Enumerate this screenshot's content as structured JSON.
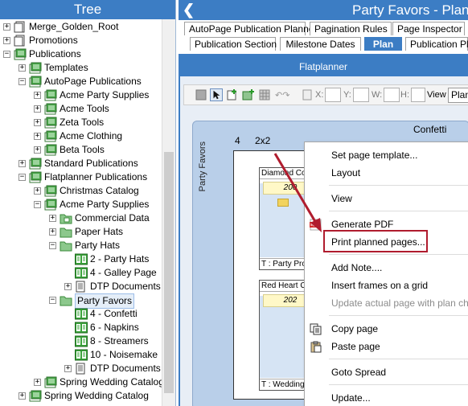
{
  "tree": {
    "title": "Tree",
    "nodes": [
      {
        "label": "Merge_Golden_Root",
        "depth": 0,
        "expander": "+",
        "icon": "page-node-icon"
      },
      {
        "label": "Promotions",
        "depth": 0,
        "expander": "+",
        "icon": "page-node-icon"
      },
      {
        "label": "Publications",
        "depth": 0,
        "expander": "-",
        "icon": "publication-node-icon"
      },
      {
        "label": "Templates",
        "depth": 1,
        "expander": "+",
        "icon": "publication-node-icon"
      },
      {
        "label": "AutoPage Publications",
        "depth": 1,
        "expander": "-",
        "icon": "publication-node-icon"
      },
      {
        "label": "Acme Party Supplies",
        "depth": 2,
        "expander": "+",
        "icon": "publication-node-icon"
      },
      {
        "label": "Acme Tools",
        "depth": 2,
        "expander": "+",
        "icon": "publication-node-icon"
      },
      {
        "label": "Zeta Tools",
        "depth": 2,
        "expander": "+",
        "icon": "publication-node-icon"
      },
      {
        "label": "Acme Clothing",
        "depth": 2,
        "expander": "+",
        "icon": "publication-node-icon"
      },
      {
        "label": "Beta Tools",
        "depth": 2,
        "expander": "+",
        "icon": "publication-node-icon"
      },
      {
        "label": "Standard Publications",
        "depth": 1,
        "expander": "+",
        "icon": "publication-node-icon"
      },
      {
        "label": "Flatplanner Publications",
        "depth": 1,
        "expander": "-",
        "icon": "publication-node-icon"
      },
      {
        "label": "Christmas Catalog",
        "depth": 2,
        "expander": "+",
        "icon": "publication-node-icon"
      },
      {
        "label": "Acme Party Supplies",
        "depth": 2,
        "expander": "-",
        "icon": "publication-node-icon"
      },
      {
        "label": "Commercial Data",
        "depth": 3,
        "expander": "+",
        "icon": "data-folder-icon"
      },
      {
        "label": "Paper Hats",
        "depth": 3,
        "expander": "+",
        "icon": "folder-icon"
      },
      {
        "label": "Party Hats",
        "depth": 3,
        "expander": "-",
        "icon": "folder-icon"
      },
      {
        "label": "2 - Party Hats",
        "depth": 4,
        "expander": "",
        "icon": "spread-icon"
      },
      {
        "label": "4 - Galley Page",
        "depth": 4,
        "expander": "",
        "icon": "spread-icon"
      },
      {
        "label": "DTP Documents",
        "depth": 4,
        "expander": "+",
        "icon": "document-icon"
      },
      {
        "label": "Party Favors",
        "depth": 3,
        "expander": "-",
        "icon": "folder-icon",
        "selected": true
      },
      {
        "label": "4 - Confetti",
        "depth": 4,
        "expander": "",
        "icon": "spread-icon"
      },
      {
        "label": "6 - Napkins",
        "depth": 4,
        "expander": "",
        "icon": "spread-icon"
      },
      {
        "label": "8 - Streamers",
        "depth": 4,
        "expander": "",
        "icon": "spread-icon"
      },
      {
        "label": "10 - Noisemake",
        "depth": 4,
        "expander": "",
        "icon": "spread-icon"
      },
      {
        "label": "DTP Documents",
        "depth": 4,
        "expander": "+",
        "icon": "document-icon"
      },
      {
        "label": "Spring Wedding Catalog",
        "depth": 2,
        "expander": "+",
        "icon": "publication-node-icon"
      },
      {
        "label": "Spring Wedding Catalog",
        "depth": 1,
        "expander": "+",
        "icon": "publication-node-icon"
      }
    ]
  },
  "plan": {
    "title": "Party Favors - Plan",
    "back_icon": "back-chevron-icon",
    "tabs_row1": [
      "AutoPage Publication Planner",
      "Pagination Rules",
      "Page Inspector"
    ],
    "tabs_row2": [
      "Publication Section",
      "Milestone Dates",
      "Plan",
      "Publication Pla"
    ],
    "active_tab": "Plan",
    "section_title": "Flatplanner",
    "toolbar": {
      "x_label": "X:",
      "y_label": "Y:",
      "w_label": "W:",
      "h_label": "H:",
      "view_label": "View",
      "view_value": "Plan"
    },
    "spread": {
      "side_label": "Party Favors",
      "page_count": "4",
      "size": "2x2",
      "plan_name": "Confetti",
      "pages": [
        {
          "title": "Diamond Co",
          "number": "200",
          "footer": "T : Party Pro"
        },
        {
          "title": "Red Heart Co",
          "number": "202",
          "footer": "T : Wedding I"
        }
      ]
    }
  },
  "context_menu": {
    "items": [
      {
        "label": "Set page template...",
        "disabled": false,
        "icon": ""
      },
      {
        "label": "Layout",
        "disabled": false,
        "icon": ""
      },
      {
        "label": "View",
        "disabled": false,
        "icon": ""
      },
      {
        "label": "Generate PDF",
        "disabled": false,
        "icon": "pdf-icon"
      },
      {
        "label": "Print planned pages...",
        "disabled": false,
        "icon": "",
        "highlighted": true
      },
      {
        "label": "Add Note....",
        "disabled": false,
        "icon": ""
      },
      {
        "label": "Insert frames on a grid",
        "disabled": false,
        "icon": ""
      },
      {
        "label": "Update actual page with plan ch",
        "disabled": true,
        "icon": ""
      },
      {
        "label": "Copy page",
        "disabled": false,
        "icon": "copy-icon"
      },
      {
        "label": "Paste page",
        "disabled": false,
        "icon": "paste-icon"
      },
      {
        "label": "Goto Spread",
        "disabled": false,
        "icon": ""
      },
      {
        "label": "Update...",
        "disabled": false,
        "icon": ""
      }
    ],
    "highlight_color": "#b01c2e"
  },
  "colors": {
    "header_blue": "#3c7dc4",
    "spread_bg": "#b9cfe9",
    "folder_green": "#3a9a3a"
  }
}
